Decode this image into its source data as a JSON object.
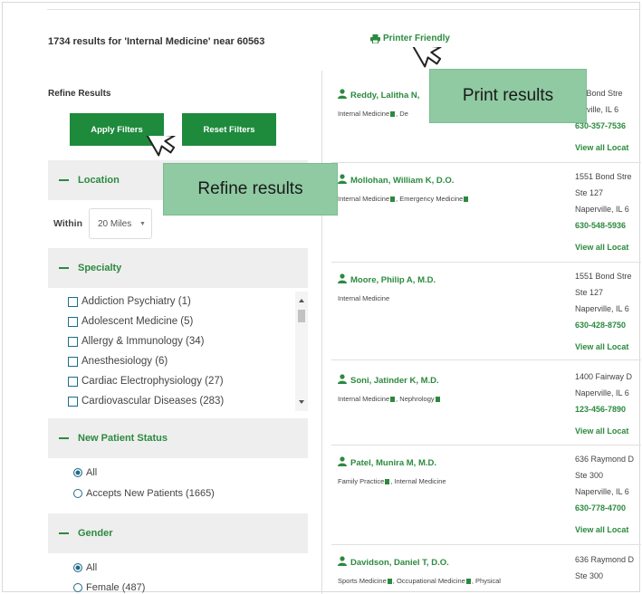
{
  "header": {
    "results_count": "1734 results for 'Internal Medicine' near 60563",
    "printer_label": "Printer Friendly"
  },
  "filters": {
    "title": "Refine Results",
    "apply_label": "Apply Filters",
    "reset_label": "Reset Filters",
    "location": {
      "heading": "Location",
      "within_label": "Within",
      "within_value": "20 Miles"
    },
    "specialty": {
      "heading": "Specialty",
      "items": [
        "Addiction Psychiatry (1)",
        "Adolescent Medicine (5)",
        "Allergy & Immunology (34)",
        "Anesthesiology (6)",
        "Cardiac Electrophysiology (27)",
        "Cardiovascular Diseases (283)"
      ]
    },
    "new_patient": {
      "heading": "New Patient Status",
      "options": [
        "All",
        "Accepts New Patients (1665)"
      ]
    },
    "gender": {
      "heading": "Gender",
      "options": [
        "All",
        "Female (487)"
      ]
    }
  },
  "doctors": [
    {
      "name": "Reddy, Lalitha N,",
      "specialties": [
        "Internal Medicine",
        "De"
      ],
      "address": [
        "20 Bond Stre",
        "perville, IL 6",
        "630-357-7536"
      ],
      "view": "View all Locat"
    },
    {
      "name": "Mollohan, William K, D.O.",
      "specialties": [
        "Internal Medicine",
        "Emergency Medicine"
      ],
      "address": [
        "1551 Bond Stre",
        "Ste 127",
        "Naperville, IL 6",
        "630-548-5936"
      ],
      "view": "View all Locat"
    },
    {
      "name": "Moore, Philip A, M.D.",
      "specialties": [
        "Internal Medicine"
      ],
      "address": [
        "1551 Bond Stre",
        "Ste 127",
        "Naperville, IL 6",
        "630-428-8750"
      ],
      "view": "View all Locat"
    },
    {
      "name": "Soni, Jatinder K, M.D.",
      "specialties": [
        "Internal Medicine",
        "Nephrology"
      ],
      "address": [
        "1400 Fairway D",
        "Naperville, IL 6",
        "123-456-7890"
      ],
      "view": "View all Locat"
    },
    {
      "name": "Patel, Munira M, M.D.",
      "specialties": [
        "Family Practice",
        "Internal Medicine"
      ],
      "address": [
        "636 Raymond D",
        "Ste 300",
        "Naperville, IL 6",
        "630-778-4700"
      ],
      "view": "View all Locat"
    },
    {
      "name": "Davidson, Daniel T, D.O.",
      "specialties": [
        "Sports Medicine",
        "Occupational Medicine",
        "Physical"
      ],
      "address": [
        "636 Raymond D",
        "Ste 300"
      ],
      "view": ""
    }
  ],
  "callouts": {
    "print": "Print results",
    "refine": "Refine results"
  },
  "colors": {
    "accent_green": "#2b8a3e",
    "button_green": "#1e8a3c",
    "callout_bg": "#8fcaa2"
  }
}
